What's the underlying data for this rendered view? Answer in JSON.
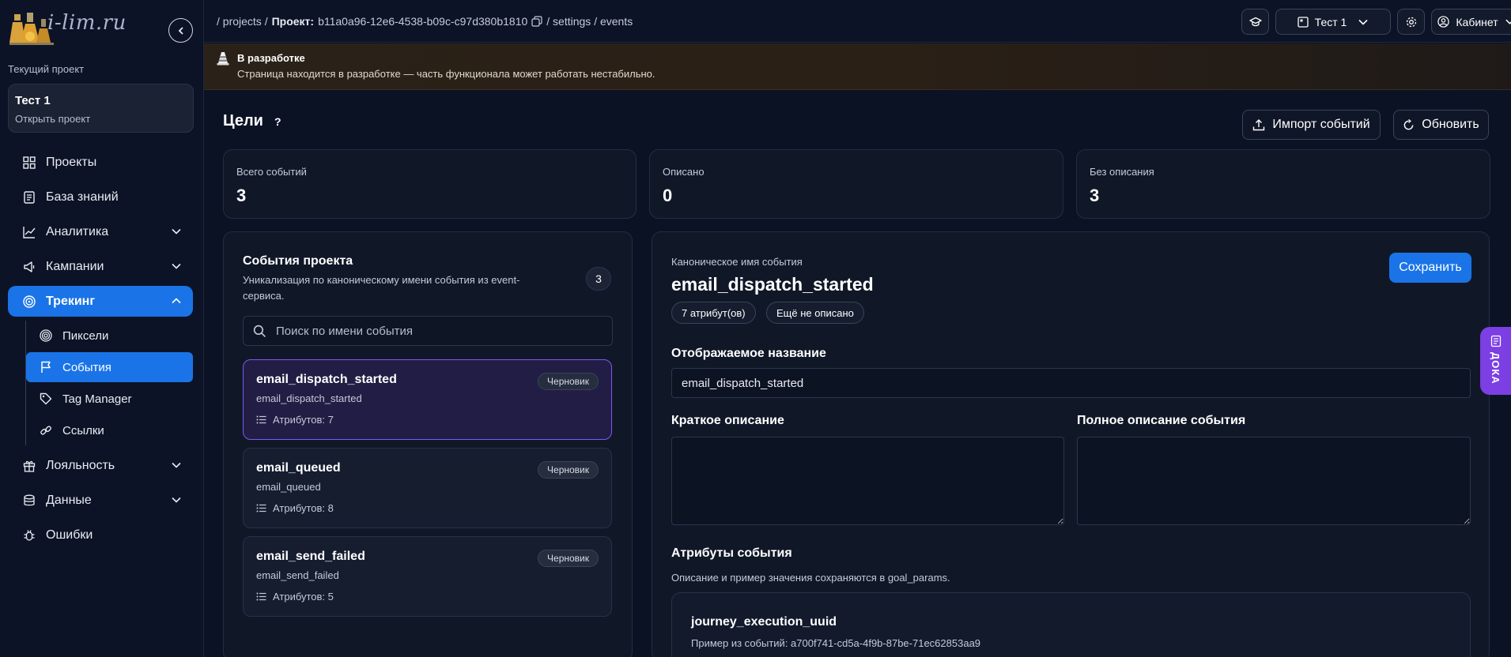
{
  "brand": {
    "logo_text": "i-lim.ru"
  },
  "sidebar": {
    "current_project_label": "Текущий проект",
    "project": {
      "name": "Тест 1",
      "action": "Открыть проект"
    },
    "nav": [
      {
        "label": "Проекты",
        "icon": "grid-icon"
      },
      {
        "label": "База знаний",
        "icon": "book-icon"
      },
      {
        "label": "Аналитика",
        "icon": "chart-icon"
      },
      {
        "label": "Кампании",
        "icon": "megaphone-icon"
      },
      {
        "label": "Трекинг",
        "icon": "target-icon"
      },
      {
        "label": "Лояльность",
        "icon": "gift-icon"
      },
      {
        "label": "Данные",
        "icon": "database-icon"
      },
      {
        "label": "Ошибки",
        "icon": "bug-icon"
      }
    ],
    "tracking_sub": [
      {
        "label": "Пиксели",
        "icon": "fingerprint-icon"
      },
      {
        "label": "События",
        "icon": "flag-icon"
      },
      {
        "label": "Tag Manager",
        "icon": "tag-icon"
      },
      {
        "label": "Ссылки",
        "icon": "link-icon"
      }
    ]
  },
  "topbar": {
    "crumb_projects": "/ projects /",
    "crumb_project_label": "Проект:",
    "crumb_project_id": "b11a0a96-12e6-4538-b09c-c97d380b1810",
    "crumb_rest": "/ settings / events",
    "project_select": "Тест 1",
    "cabinet": "Кабинет"
  },
  "banner": {
    "title": "В разработке",
    "text": "Страница находится в разработке — часть функционала может работать нестабильно."
  },
  "page": {
    "title": "Цели",
    "help": "?",
    "import_label": "Импорт событий",
    "refresh_label": "Обновить"
  },
  "stats": [
    {
      "label": "Всего событий",
      "value": "3"
    },
    {
      "label": "Описано",
      "value": "0"
    },
    {
      "label": "Без описания",
      "value": "3"
    }
  ],
  "events_panel": {
    "title": "События проекта",
    "subtitle": "Уникализация по каноническому имени события из event-сервиса.",
    "count": "3",
    "search_placeholder": "Поиск по имени события",
    "events": [
      {
        "name": "email_dispatch_started",
        "canonical": "email_dispatch_started",
        "attrs": "Атрибутов: 7",
        "status": "Черновик"
      },
      {
        "name": "email_queued",
        "canonical": "email_queued",
        "attrs": "Атрибутов: 8",
        "status": "Черновик"
      },
      {
        "name": "email_send_failed",
        "canonical": "email_send_failed",
        "attrs": "Атрибутов: 5",
        "status": "Черновик"
      }
    ]
  },
  "detail": {
    "canonical_label": "Каноническое имя события",
    "name": "email_dispatch_started",
    "chip_attrs": "7 атрибут(ов)",
    "chip_status": "Ещё не описано",
    "save_label": "Сохранить",
    "display_name_label": "Отображаемое название",
    "display_name_value": "email_dispatch_started",
    "short_desc_label": "Краткое описание",
    "full_desc_label": "Полное описание события",
    "attrs_title": "Атрибуты события",
    "attrs_subtitle": "Описание и пример значения сохраняются в goal_params.",
    "attr_first": {
      "name": "journey_execution_uuid",
      "example": "Пример из событий: a700f741-cd5a-4f9b-87be-71ec62853aa9"
    }
  },
  "doka_label": "ДОКА"
}
